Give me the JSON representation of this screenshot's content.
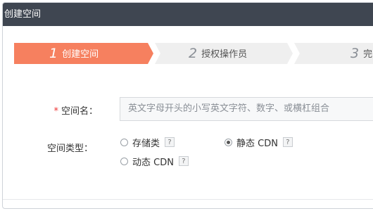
{
  "dialog": {
    "title": "创建空间"
  },
  "steps": [
    {
      "num": "1",
      "label": "创建空间"
    },
    {
      "num": "2",
      "label": "授权操作员"
    },
    {
      "num": "3",
      "label": "完"
    }
  ],
  "form": {
    "space_name": {
      "required_mark": "*",
      "label": "空间名：",
      "placeholder": "英文字母开头的小写英文字符、数字、或横杠组合",
      "value": ""
    },
    "space_type": {
      "label": "空间类型：",
      "options": [
        {
          "label": "存储类",
          "selected": false,
          "help": "?"
        },
        {
          "label": "静态 CDN",
          "selected": true,
          "help": "?"
        },
        {
          "label": "动态 CDN",
          "selected": false,
          "help": "?"
        }
      ]
    }
  },
  "colors": {
    "titlebar": "#3f4651",
    "active_step": "#f6805f",
    "required": "#ee3333"
  }
}
